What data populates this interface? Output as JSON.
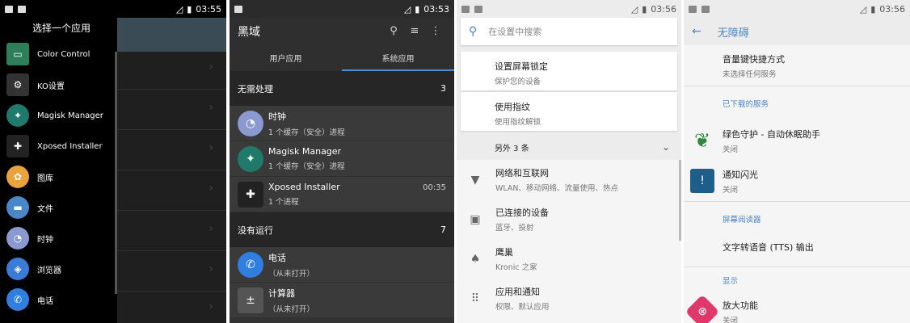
{
  "screen1": {
    "status_time": "03:55",
    "drawer_title": "选择一个应用",
    "apps": [
      {
        "label": "Color Control",
        "icon": "monitor-icon",
        "color": "#2e7d5b"
      },
      {
        "label": "KO设置",
        "icon": "gear-icon",
        "color": "#333333"
      },
      {
        "label": "Magisk Manager",
        "icon": "magisk-icon",
        "color": "#1f7a6b"
      },
      {
        "label": "Xposed Installer",
        "icon": "xposed-icon",
        "color": "#222222"
      },
      {
        "label": "图库",
        "icon": "gallery-icon",
        "color": "#e8a33d"
      },
      {
        "label": "文件",
        "icon": "folder-icon",
        "color": "#4a87c9"
      },
      {
        "label": "时钟",
        "icon": "clock-icon",
        "color": "#8a9ad0"
      },
      {
        "label": "浏览器",
        "icon": "browser-icon",
        "color": "#3b7bd8"
      },
      {
        "label": "电话",
        "icon": "phone-icon",
        "color": "#2f7ee0"
      }
    ]
  },
  "screen2": {
    "status_time": "03:53",
    "title": "黑域",
    "tabs": [
      {
        "label": "用户应用",
        "active": false
      },
      {
        "label": "系统应用",
        "active": true
      }
    ],
    "sections": [
      {
        "title": "无需处理",
        "count": "3",
        "rows": [
          {
            "name": "时钟",
            "sub": "1 个缓存（安全）进程",
            "time": "",
            "icon": "clock-icon",
            "color": "#8a9ad0"
          },
          {
            "name": "Magisk Manager",
            "sub": "1 个缓存（安全）进程",
            "time": "",
            "icon": "magisk-icon",
            "color": "#1f7a6b"
          },
          {
            "name": "Xposed Installer",
            "sub": "1 个进程",
            "time": "00:35",
            "icon": "xposed-icon",
            "color": "#222222"
          }
        ]
      },
      {
        "title": "没有运行",
        "count": "7",
        "rows": [
          {
            "name": "电话",
            "sub": "（从未打开）",
            "time": "",
            "icon": "phone-icon",
            "color": "#2f7ee0"
          },
          {
            "name": "计算器",
            "sub": "（从未打开）",
            "time": "",
            "icon": "calculator-icon",
            "color": "#555555"
          }
        ]
      }
    ]
  },
  "screen3": {
    "status_time": "03:56",
    "search_placeholder": "在设置中搜索",
    "cards": [
      {
        "title": "设置屏幕锁定",
        "sub": "保护您的设备"
      },
      {
        "title": "使用指纹",
        "sub": "使用指纹解锁"
      }
    ],
    "more_label": "另外 3 条",
    "items": [
      {
        "title": "网络和互联网",
        "sub": "WLAN、移动网络、流量使用、热点",
        "icon": "wifi-icon"
      },
      {
        "title": "已连接的设备",
        "sub": "蓝牙、投射",
        "icon": "devices-icon"
      },
      {
        "title": "鹰巢",
        "sub": "Kronic 之家",
        "icon": "nest-icon"
      },
      {
        "title": "应用和通知",
        "sub": "权限、默认应用",
        "icon": "apps-grid-icon"
      }
    ]
  },
  "screen4": {
    "status_time": "03:56",
    "title": "无障碍",
    "volume_shortcut": {
      "title": "音量键快捷方式",
      "sub": "未选择任何服务"
    },
    "downloaded_label": "已下载的服务",
    "services": [
      {
        "title": "绿色守护 - 自动休眠助手",
        "sub": "关闭",
        "icon": "greenify-leaf-icon",
        "color": "#2e8b3e"
      },
      {
        "title": "通知闪光",
        "sub": "关闭",
        "icon": "notification-flash-icon",
        "color": "#1e5f8a"
      }
    ],
    "screen_reader_label": "屏幕阅读器",
    "tts_label": "文字转语音 (TTS) 输出",
    "display_label": "显示",
    "magnify": {
      "title": "放大功能",
      "sub": "关闭",
      "icon": "magnify-icon",
      "color": "#e0386b"
    }
  }
}
